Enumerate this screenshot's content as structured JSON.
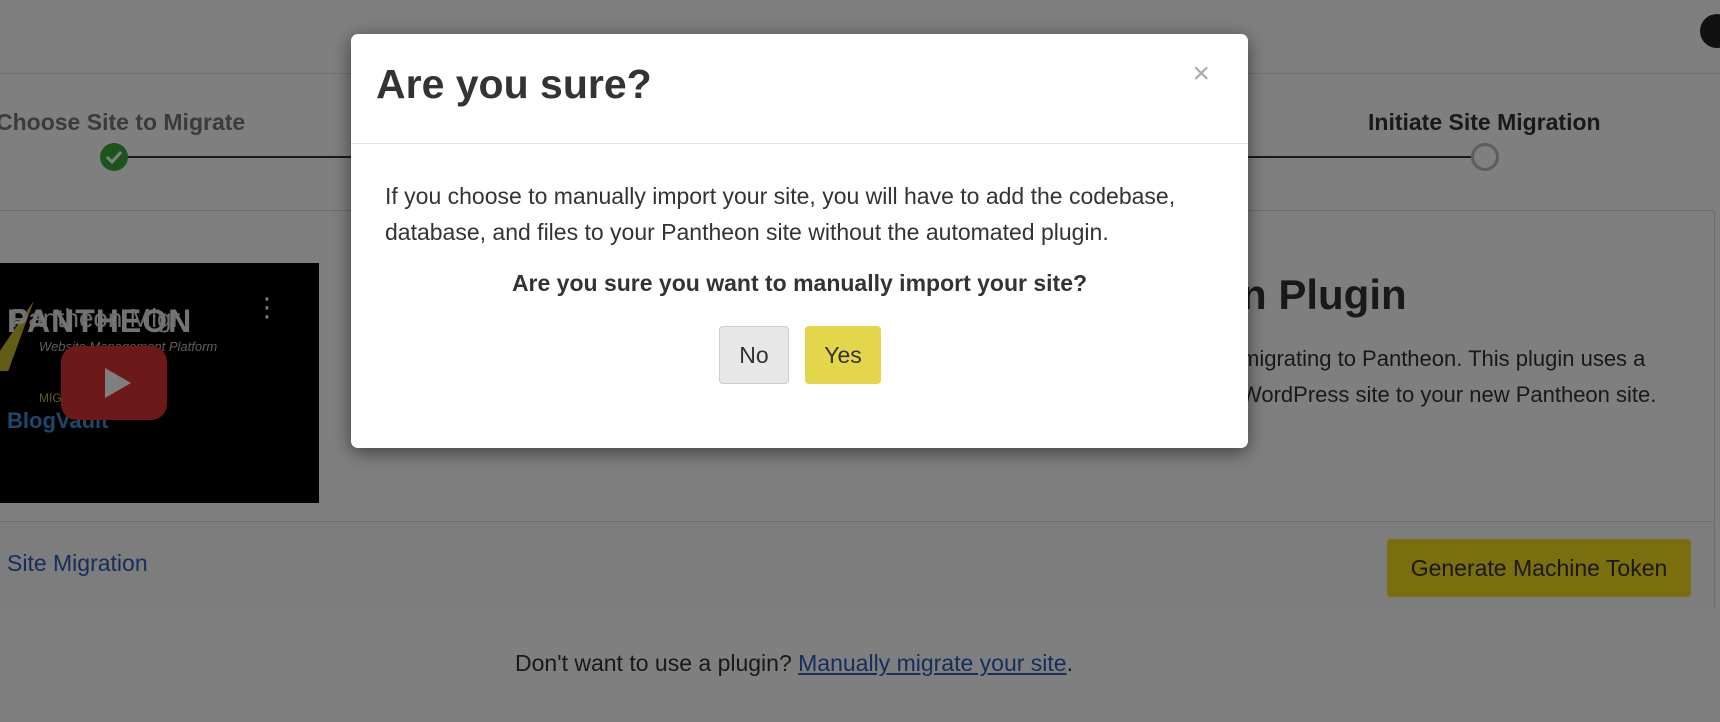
{
  "steps": [
    {
      "label": "Choose Site to Migrate",
      "status": "done"
    },
    {
      "label": "Initiate Site Migration",
      "status": "pending"
    }
  ],
  "video": {
    "title": "Pantheon Migr",
    "brand": "PANTHEON",
    "tagline": "Website Management Platform",
    "partner_label": "MIG",
    "partner_brand": "BlogVault",
    "menu_icon": "more-vertical-icon",
    "play_icon": "play-icon"
  },
  "plugin": {
    "title_partial": "n Plugin",
    "description_partial": "migrating to Pantheon. This plugin uses a WordPress site to your new Pantheon site."
  },
  "card_footer": {
    "link_label": "Site Migration",
    "token_button": "Generate Machine Token"
  },
  "bottom": {
    "prefix": "Don't want to use a plugin? ",
    "link": "Manually migrate your site",
    "suffix": "."
  },
  "modal": {
    "title": "Are you sure?",
    "close_label": "×",
    "body": "If you choose to manually import your site, you will have to add the codebase, database, and files to your Pantheon site without the automated plugin.",
    "question": "Are you sure you want to manually import your site?",
    "no_label": "No",
    "yes_label": "Yes"
  },
  "colors": {
    "accent_yellow": "#f5dc1c",
    "link_blue": "#2a5cb8",
    "success_green": "#3aa63a"
  }
}
